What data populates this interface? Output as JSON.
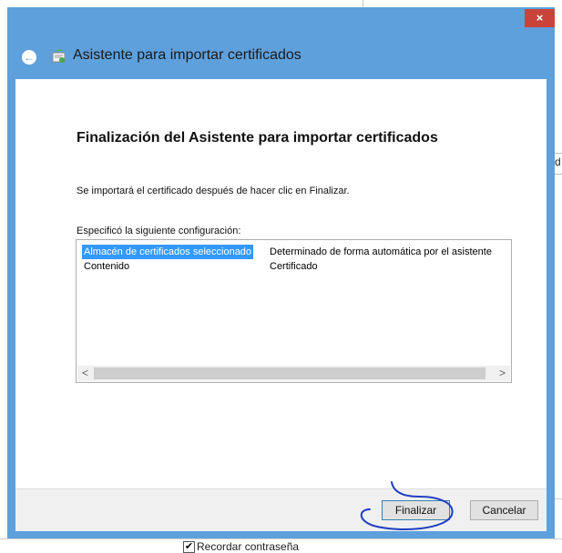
{
  "background": {
    "right_edge_text": "d",
    "remember_password_label": "Recordar contraseña",
    "remember_password_checked": true
  },
  "window": {
    "close_glyph": "×",
    "title": "Asistente para importar certificados",
    "back_icon": "back-arrow-icon",
    "app_icon": "certificate-icon",
    "accent_color": "#5ea0dc",
    "close_color": "#c8443a"
  },
  "content": {
    "heading": "Finalización del Asistente para importar certificados",
    "info": "Se importará el certificado después de hacer clic en Finalizar.",
    "specified_label": "Especificó la siguiente configuración:",
    "settings": [
      {
        "name": "Almacén de certificados seleccionado",
        "value": "Determinado de forma automática por el asistente",
        "selected": true
      },
      {
        "name": "Contenido",
        "value": "Certificado",
        "selected": false
      }
    ],
    "scroll_left": "<",
    "scroll_right": ">"
  },
  "buttons": {
    "finish": "Finalizar",
    "cancel": "Cancelar"
  }
}
